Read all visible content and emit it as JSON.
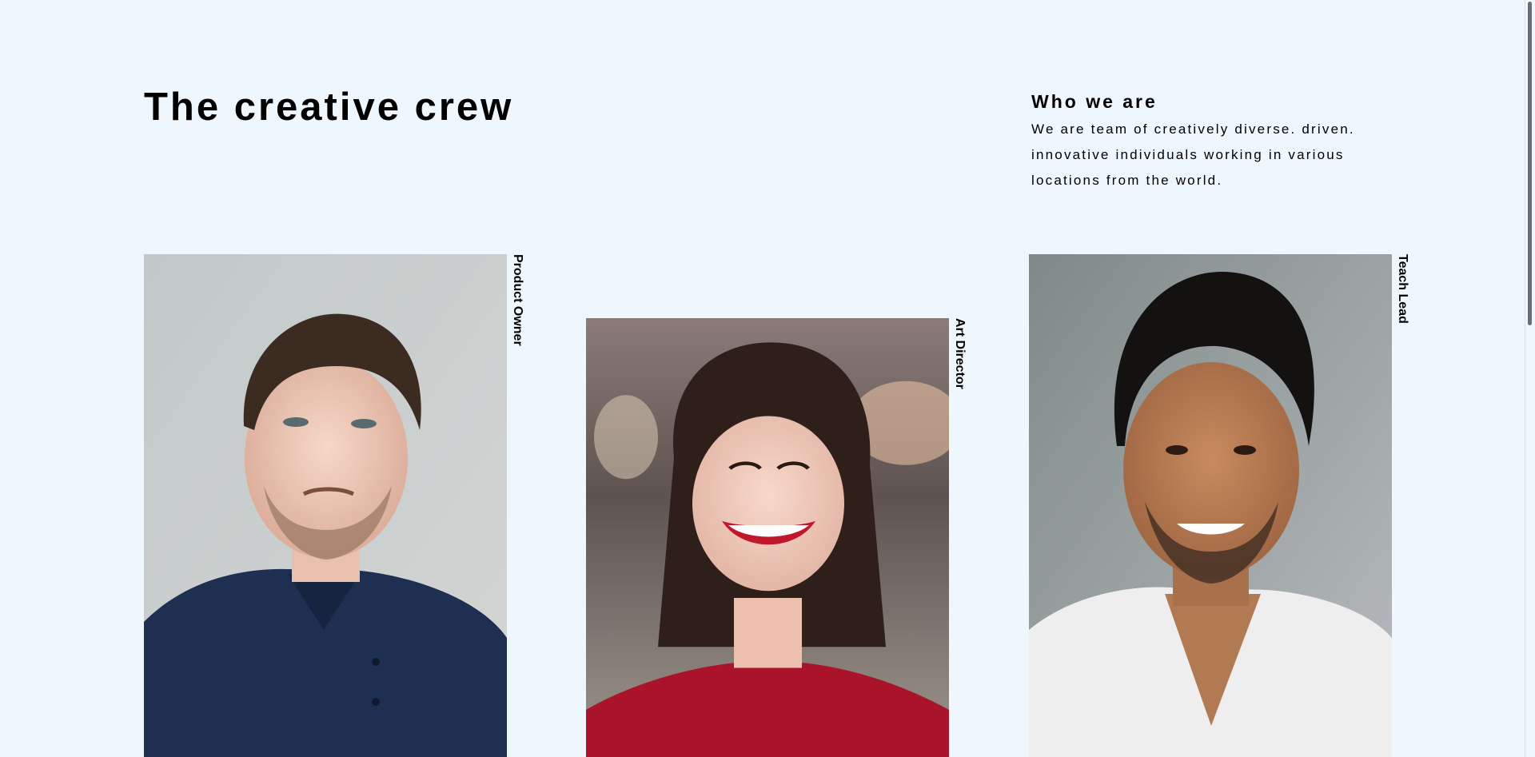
{
  "header": {
    "title": "The creative crew"
  },
  "about": {
    "heading": "Who we are",
    "text": "We are team of creatively diverse. driven. innovative individuals working in various locations from the world."
  },
  "team": [
    {
      "role": "Product Owner",
      "photo_subject": "man-portrait-navy-polo"
    },
    {
      "role": "Art Director",
      "photo_subject": "woman-portrait-red-top"
    },
    {
      "role": "Teach Lead",
      "photo_subject": "man-portrait-white-tshirt"
    }
  ],
  "colors": {
    "background": "#eef6fe",
    "text": "#000000"
  }
}
